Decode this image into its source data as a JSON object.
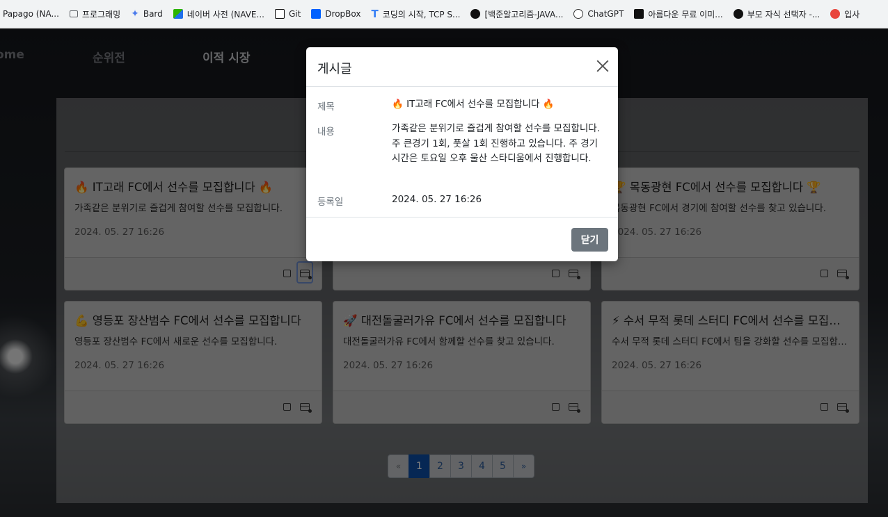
{
  "bookmarks": [
    {
      "label": "Papago (NA...",
      "icon": "papago-icon"
    },
    {
      "label": "프로그래밍",
      "icon": "folder-icon"
    },
    {
      "label": "Bard",
      "icon": "bard-icon"
    },
    {
      "label": "네이버 사전 (NAVE...",
      "icon": "naver-dict-icon"
    },
    {
      "label": "Git",
      "icon": "notion-icon"
    },
    {
      "label": "DropBox",
      "icon": "dropbox-icon"
    },
    {
      "label": "코딩의 시작, TCP S...",
      "icon": "tcp-school-icon"
    },
    {
      "label": "[백준알고리즘-JAVA...",
      "icon": "baekjoon-icon"
    },
    {
      "label": "ChatGPT",
      "icon": "chatgpt-icon"
    },
    {
      "label": "아름다운 무료 이미...",
      "icon": "unsplash-icon"
    },
    {
      "label": "부모 자식 선택자 -...",
      "icon": "circle-icon"
    },
    {
      "label": "입사",
      "icon": "red-circle-icon"
    }
  ],
  "nav": {
    "home": "ome",
    "ranking": "순위전",
    "transfer": "이적 시장"
  },
  "cards": [
    {
      "title": "🔥 IT고래 FC에서 선수를 모집합니다 🔥",
      "content": "가족같은 분위기로 즐겁게 참여할 선수를 모집합니다.",
      "date": "2024. 05. 27 16:26"
    },
    {
      "title": "",
      "content": "",
      "date": ""
    },
    {
      "title": "🏆 목동광현 FC에서 선수를 모집합니다 🏆",
      "content": "목동광현 FC에서 경기에 참여할 선수를 찾고 있습니다.",
      "date": "2024. 05. 27 16:26"
    },
    {
      "title": "💪 영등포 장산범수 FC에서 선수를 모집합니다",
      "content": "영등포 장산범수 FC에서 새로운 선수를 모집합니다.",
      "date": "2024. 05. 27 16:26"
    },
    {
      "title": "🚀 대전돌굴러가유 FC에서 선수를 모집합니다",
      "content": "대전돌굴러가유 FC에서 함께할 선수를 찾고 있습니다.",
      "date": "2024. 05. 27 16:26"
    },
    {
      "title": "⚡ 수서 무적 롯데 스터디 FC에서 선수를 모집합니다",
      "content": "수서 무적 롯데 스터디 FC에서 팀을 강화할 선수를 모집합니다.",
      "date": "2024. 05. 27 16:26"
    }
  ],
  "pagination": {
    "prev": "«",
    "pages": [
      "1",
      "2",
      "3",
      "4",
      "5"
    ],
    "next": "»",
    "active": "1"
  },
  "modal": {
    "title": "게시글",
    "title_label": "제목",
    "title_value": "🔥 IT고래 FC에서 선수를 모집합니다 🔥",
    "content_label": "내용",
    "content_value": "가족같은 분위기로 즐겁게 참여할 선수를 모집합니다. 주 큰경기 1회, 풋살 1회 진행하고 있습니다. 주 경기 시간은 토요일 오후 울산 스타디움에서 진행합니다.",
    "date_label": "등록일",
    "date_value": "2024. 05. 27 16:26",
    "close_button": "닫기"
  },
  "colors": {
    "active_page": "#0d4ea8",
    "close_button": "#6c757d"
  }
}
